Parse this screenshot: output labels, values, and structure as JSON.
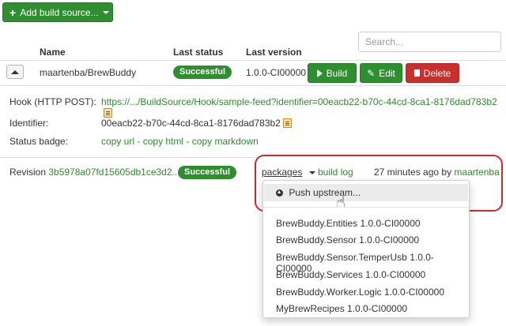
{
  "toolbar": {
    "add_label": "Add build source..."
  },
  "search": {
    "placeholder": "Search..."
  },
  "table": {
    "headers": {
      "name": "Name",
      "last_status": "Last status",
      "last_version": "Last version"
    },
    "row": {
      "name": "maartenba/BrewBuddy",
      "status": "Successful",
      "version": "1.0.0-CI00000",
      "build_label": "Build",
      "edit_label": "Edit",
      "delete_label": "Delete"
    }
  },
  "details": {
    "hook_label": "Hook (HTTP POST):",
    "hook_url": "https://.../BuildSource/Hook/sample-feed?identifier=00eacb22-b70c-44cd-8ca1-8176dad783b2",
    "identifier_label": "Identifier:",
    "identifier_value": "00eacb22-b70c-44cd-8ca1-8176dad783b2",
    "status_badge_label": "Status badge:",
    "copy_url": "copy url",
    "copy_html": "copy html",
    "copy_markdown": "copy markdown",
    "sep": "-"
  },
  "revision": {
    "label": "Revision",
    "hash": "3b5978a07fd15605db1ce3d2...",
    "status": "Successful",
    "packages_label": "packages",
    "build_log_label": "build log",
    "time_text": "27 minutes ago by",
    "author": "maartenba"
  },
  "packages_menu": {
    "push_label": "Push upstream...",
    "items": [
      "BrewBuddy.Entities 1.0.0-CI00000",
      "BrewBuddy.Sensor 1.0.0-CI00000",
      "BrewBuddy.Sensor.TemperUsb 1.0.0-CI00000",
      "BrewBuddy.Services 1.0.0-CI00000",
      "BrewBuddy.Worker.Logic 1.0.0-CI00000",
      "MyBrewRecipes 1.0.0-CI00000"
    ]
  },
  "colors": {
    "accent_green": "#2d8f2d",
    "danger_red": "#c9302c",
    "highlight_red": "#d9252c"
  }
}
